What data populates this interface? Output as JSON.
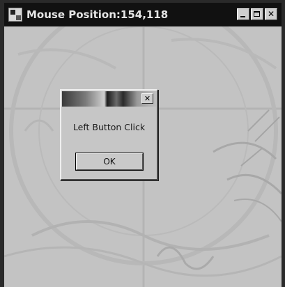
{
  "window": {
    "title": "Mouse Position:154,118",
    "icon": "application-window-icon",
    "controls": {
      "minimize": "minimize-icon",
      "maximize": "maximize-icon",
      "close": "close-icon",
      "close_glyph": "✕"
    }
  },
  "dialog": {
    "close_glyph": "✕",
    "message": "Left Button Click",
    "ok_label": "OK"
  },
  "colors": {
    "titlebar": "#111111",
    "client_background": "#c3c3c3",
    "dialog_face": "#c6c6c6"
  }
}
